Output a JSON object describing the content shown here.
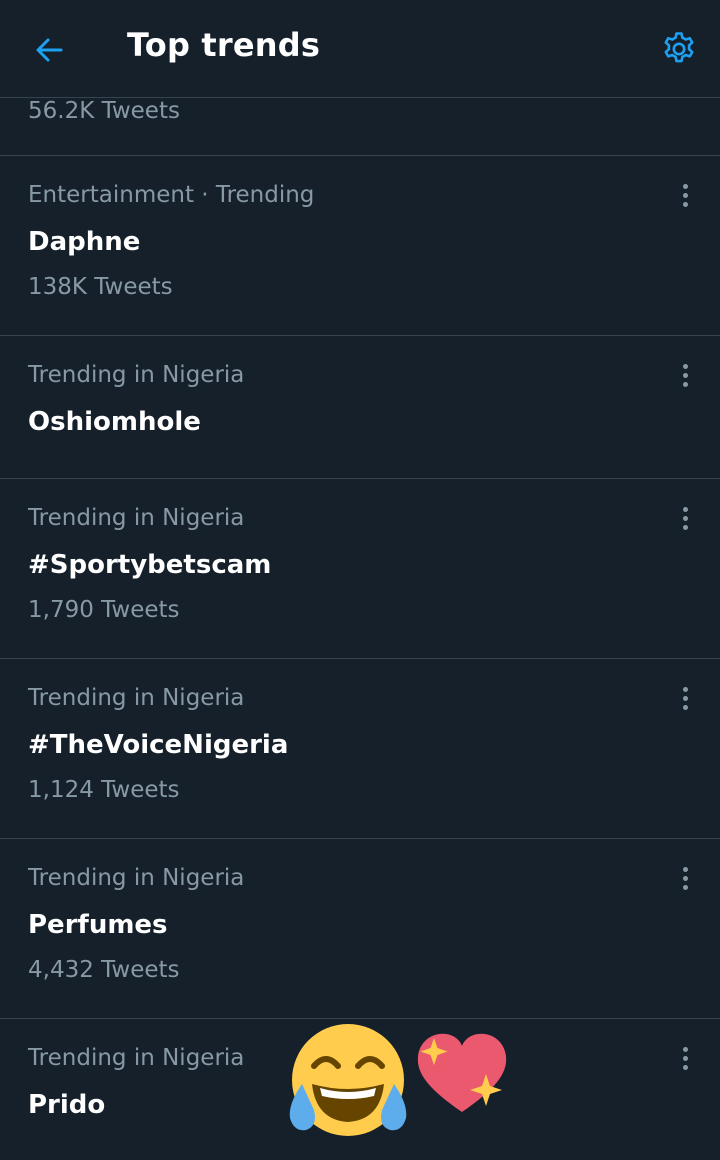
{
  "header": {
    "title": "Top trends",
    "back_icon": "arrow-left-icon",
    "settings_icon": "gear-icon",
    "accent_color": "#1da1f2"
  },
  "partial_trend": {
    "count": "56.2K Tweets"
  },
  "trends": [
    {
      "context": "Entertainment · Trending",
      "name": "Daphne",
      "count": "138K Tweets"
    },
    {
      "context": "Trending in Nigeria",
      "name": "Oshiomhole",
      "count": ""
    },
    {
      "context": "Trending in Nigeria",
      "name": "#Sportybetscam",
      "count": "1,790 Tweets"
    },
    {
      "context": "Trending in Nigeria",
      "name": "#TheVoiceNigeria",
      "count": "1,124 Tweets"
    },
    {
      "context": "Trending in Nigeria",
      "name": "Perfumes",
      "count": "4,432 Tweets"
    },
    {
      "context": "Trending in Nigeria",
      "name": "Prido",
      "count": ""
    }
  ],
  "stickers": [
    "face-with-tears-of-joy-emoji",
    "sparkling-heart-emoji"
  ],
  "colors": {
    "background": "#15202b",
    "divider": "#38444d",
    "secondary_text": "#8899a6",
    "primary_text": "#ffffff"
  }
}
